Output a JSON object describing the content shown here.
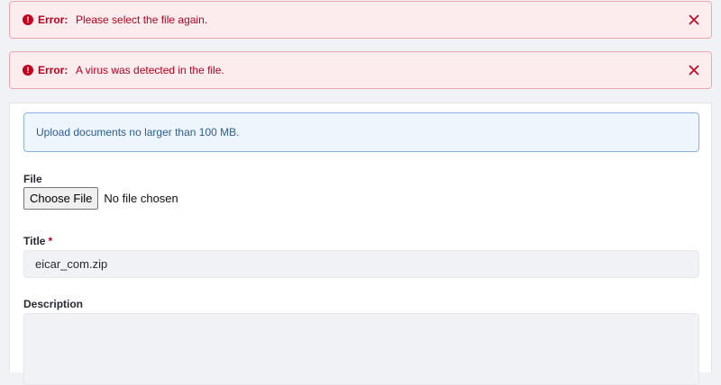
{
  "alerts": [
    {
      "label": "Error:",
      "message": "Please select the file again.",
      "icon": "exclamation-circle-icon",
      "close_icon": "close-icon"
    },
    {
      "label": "Error:",
      "message": "A virus was detected in the file.",
      "icon": "exclamation-circle-icon",
      "close_icon": "close-icon"
    }
  ],
  "info": {
    "text": "Upload documents no larger than 100 MB."
  },
  "form": {
    "file_label": "File",
    "choose_button": "Choose File",
    "no_file_text": "No file chosen",
    "title_label": "Title",
    "title_required_mark": "*",
    "title_value": "eicar_com.zip",
    "description_label": "Description",
    "description_value": ""
  },
  "colors": {
    "error": "#b8001c",
    "error_bg": "#fdecee",
    "info": "#2b5e94",
    "info_bg": "#eef5fd"
  }
}
